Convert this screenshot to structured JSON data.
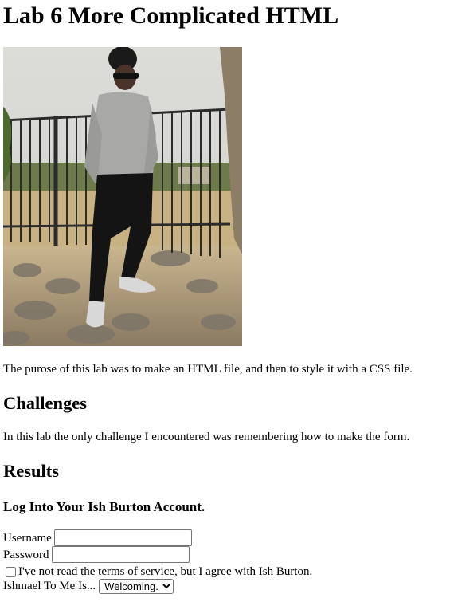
{
  "page": {
    "title": "Lab 6 More Complicated HTML",
    "intro": "The purose of this lab was to make an HTML file, and then to style it with a CSS file.",
    "challenges_heading": "Challenges",
    "challenges_text": "In this lab the only challenge I encountered was remembering how to make the form.",
    "results_heading": "Results"
  },
  "form": {
    "title": "Log Into Your Ish Burton Account.",
    "username_label": "Username",
    "username_value": "",
    "password_label": "Password",
    "password_value": "",
    "tos_before": "I've not read the ",
    "tos_link": "terms of service",
    "tos_after": ", but I agree with Ish Burton.",
    "tos_checked": false,
    "select_label": "Ishmael To Me Is...",
    "select_value": "Welcoming."
  }
}
